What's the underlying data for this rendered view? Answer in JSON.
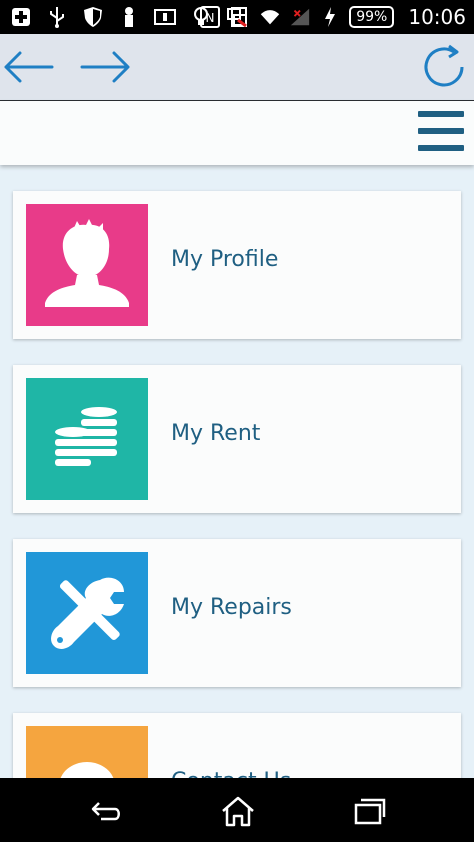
{
  "status_bar": {
    "battery": "99%",
    "time": "10:06",
    "icons": [
      "plus-icon",
      "usb-icon",
      "shield-icon",
      "lock-icon",
      "sim-icon",
      "bulb-icon",
      "screen-icon",
      "nfc-icon",
      "signal-off-icon",
      "wifi-icon",
      "cell-signal-icon",
      "charging-icon"
    ]
  },
  "browser": {
    "back_icon": "arrow-left-icon",
    "forward_icon": "arrow-right-icon",
    "reload_icon": "refresh-icon"
  },
  "menu": {
    "icon": "hamburger-icon"
  },
  "cards": [
    {
      "label": "My Profile",
      "color": "#e83b89",
      "icon": "person-icon"
    },
    {
      "label": "My Rent",
      "color": "#1fb6a6",
      "icon": "coins-icon"
    },
    {
      "label": "My Repairs",
      "color": "#2197d8",
      "icon": "tools-icon"
    },
    {
      "label": "Contact Us",
      "color": "#f5a53f",
      "icon": "chat-icon"
    }
  ],
  "bottom_nav": [
    "back-icon",
    "home-icon",
    "recents-icon"
  ]
}
